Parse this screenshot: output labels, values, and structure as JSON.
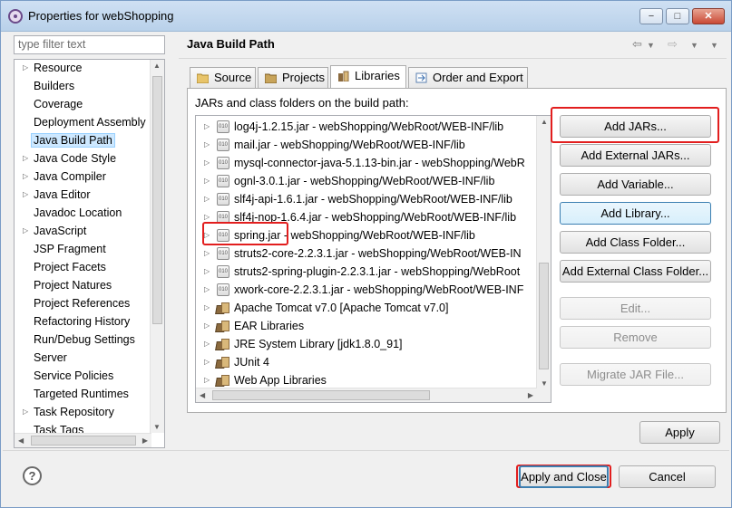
{
  "window": {
    "title": "Properties for webShopping",
    "minimize": "−",
    "maximize": "□",
    "close": "✕"
  },
  "filter": {
    "placeholder": "type filter text"
  },
  "nav": {
    "items": [
      {
        "label": "Resource",
        "expandable": true
      },
      {
        "label": "Builders",
        "expandable": false
      },
      {
        "label": "Coverage",
        "expandable": false
      },
      {
        "label": "Deployment Assembly",
        "expandable": false
      },
      {
        "label": "Java Build Path",
        "expandable": false,
        "selected": true
      },
      {
        "label": "Java Code Style",
        "expandable": true
      },
      {
        "label": "Java Compiler",
        "expandable": true
      },
      {
        "label": "Java Editor",
        "expandable": true
      },
      {
        "label": "Javadoc Location",
        "expandable": false
      },
      {
        "label": "JavaScript",
        "expandable": true
      },
      {
        "label": "JSP Fragment",
        "expandable": false
      },
      {
        "label": "Project Facets",
        "expandable": false
      },
      {
        "label": "Project Natures",
        "expandable": false
      },
      {
        "label": "Project References",
        "expandable": false
      },
      {
        "label": "Refactoring History",
        "expandable": false
      },
      {
        "label": "Run/Debug Settings",
        "expandable": false
      },
      {
        "label": "Server",
        "expandable": false
      },
      {
        "label": "Service Policies",
        "expandable": false
      },
      {
        "label": "Targeted Runtimes",
        "expandable": false
      },
      {
        "label": "Task Repository",
        "expandable": true
      },
      {
        "label": "Task Tags",
        "expandable": false
      }
    ]
  },
  "header": {
    "title": "Java Build Path"
  },
  "tabs": [
    {
      "label": "Source"
    },
    {
      "label": "Projects"
    },
    {
      "label": "Libraries",
      "active": true
    },
    {
      "label": "Order and Export"
    }
  ],
  "panel": {
    "label": "JARs and class folders on the build path:",
    "entries": [
      {
        "text": "log4j-1.2.15.jar - webShopping/WebRoot/WEB-INF/lib",
        "icon": "jar"
      },
      {
        "text": "mail.jar - webShopping/WebRoot/WEB-INF/lib",
        "icon": "jar"
      },
      {
        "text": "mysql-connector-java-5.1.13-bin.jar - webShopping/WebR",
        "icon": "jar"
      },
      {
        "text": "ognl-3.0.1.jar - webShopping/WebRoot/WEB-INF/lib",
        "icon": "jar"
      },
      {
        "text": "slf4j-api-1.6.1.jar - webShopping/WebRoot/WEB-INF/lib",
        "icon": "jar"
      },
      {
        "text": "slf4j-nop-1.6.4.jar - webShopping/WebRoot/WEB-INF/lib",
        "icon": "jar"
      },
      {
        "text": "spring.jar - webShopping/WebRoot/WEB-INF/lib",
        "icon": "jar",
        "highlighted": true
      },
      {
        "text": "struts2-core-2.2.3.1.jar - webShopping/WebRoot/WEB-IN",
        "icon": "jar"
      },
      {
        "text": "struts2-spring-plugin-2.2.3.1.jar - webShopping/WebRoot",
        "icon": "jar"
      },
      {
        "text": "xwork-core-2.2.3.1.jar - webShopping/WebRoot/WEB-INF",
        "icon": "jar"
      },
      {
        "text": "Apache Tomcat v7.0 [Apache Tomcat v7.0]",
        "icon": "library"
      },
      {
        "text": "EAR Libraries",
        "icon": "library"
      },
      {
        "text": "JRE System Library [jdk1.8.0_91]",
        "icon": "library"
      },
      {
        "text": "JUnit 4",
        "icon": "library"
      },
      {
        "text": "Web App Libraries",
        "icon": "library"
      }
    ],
    "icon_jar_text": "010"
  },
  "buttons": {
    "add_jars": "Add JARs...",
    "add_external_jars": "Add External JARs...",
    "add_variable": "Add Variable...",
    "add_library": "Add Library...",
    "add_class_folder": "Add Class Folder...",
    "add_external_class_folder": "Add External Class Folder...",
    "edit": "Edit...",
    "remove": "Remove",
    "migrate_jar": "Migrate JAR File...",
    "apply": "Apply",
    "apply_and_close": "Apply and Close",
    "cancel": "Cancel"
  },
  "help": {
    "symbol": "?"
  },
  "colors": {
    "highlight": "#e21e1e",
    "selection": "#cde8ff",
    "title_bar": "#b9d1ea"
  }
}
